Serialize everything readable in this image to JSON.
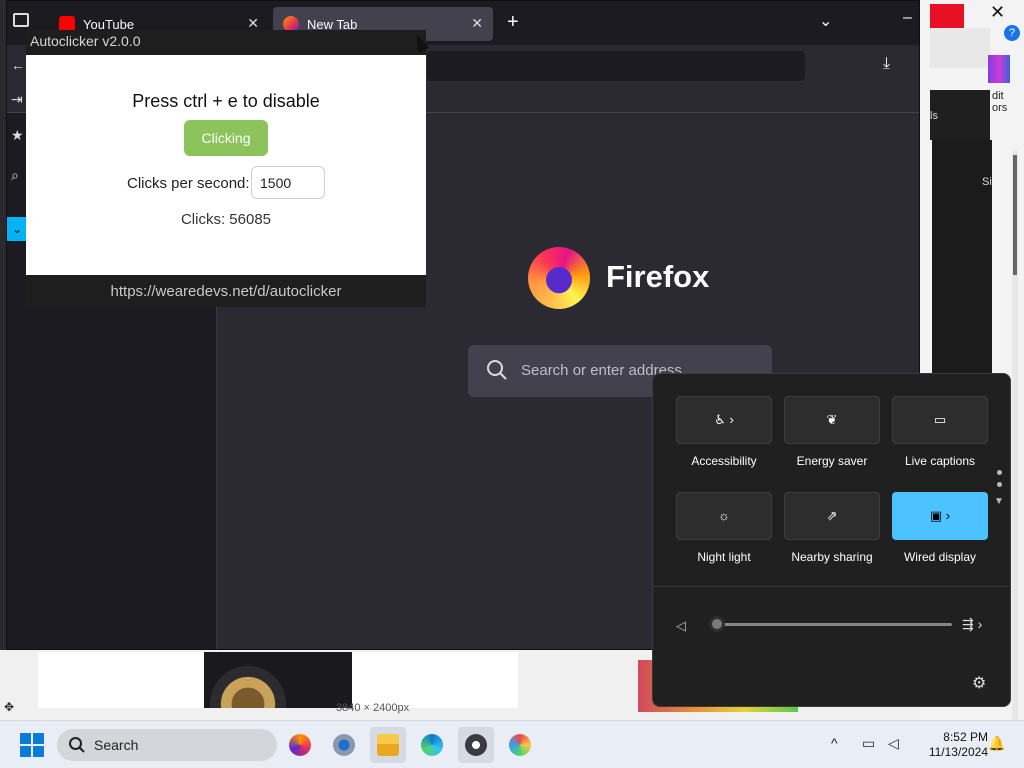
{
  "firefox": {
    "tabs": [
      {
        "label": "YouTube"
      },
      {
        "label": "New Tab"
      }
    ],
    "wordmark": "Firefox",
    "search_placeholder": "Search or enter address"
  },
  "autoclicker": {
    "title": "Autoclicker v2.0.0",
    "heading": "Press ctrl + e to disable",
    "button_label": "Clicking",
    "cps_label": "Clicks per second:",
    "cps_value": "1500",
    "clicks_text": "Clicks: 56085",
    "url": "https://wearedevs.net/d/autoclicker",
    "accent_color": "#8cc35a"
  },
  "quick_settings": {
    "tiles": [
      {
        "label": "Accessibility",
        "icon": "accessibility-icon",
        "active": false,
        "has_chevron": true
      },
      {
        "label": "Energy saver",
        "icon": "leaf-icon",
        "active": false,
        "has_chevron": false
      },
      {
        "label": "Live captions",
        "icon": "captions-icon",
        "active": false,
        "has_chevron": false
      },
      {
        "label": "Night light",
        "icon": "sun-icon",
        "active": false,
        "has_chevron": false
      },
      {
        "label": "Nearby sharing",
        "icon": "share-icon",
        "active": false,
        "has_chevron": false
      },
      {
        "label": "Wired display",
        "icon": "cast-icon",
        "active": true,
        "has_chevron": true
      }
    ],
    "volume_level": 0.0,
    "accent_color": "#4cc2ff"
  },
  "background": {
    "right_labels": [
      "dit",
      "ors",
      "ls",
      "Si"
    ],
    "bottom_status": "3840 × 2400px"
  },
  "taskbar": {
    "search_label": "Search",
    "apps": [
      "firefox-icon",
      "settings-icon",
      "file-explorer-icon",
      "edge-icon",
      "autoclicker-app-icon",
      "paint-icon"
    ],
    "time": "8:52 PM",
    "date": "11/13/2024"
  }
}
